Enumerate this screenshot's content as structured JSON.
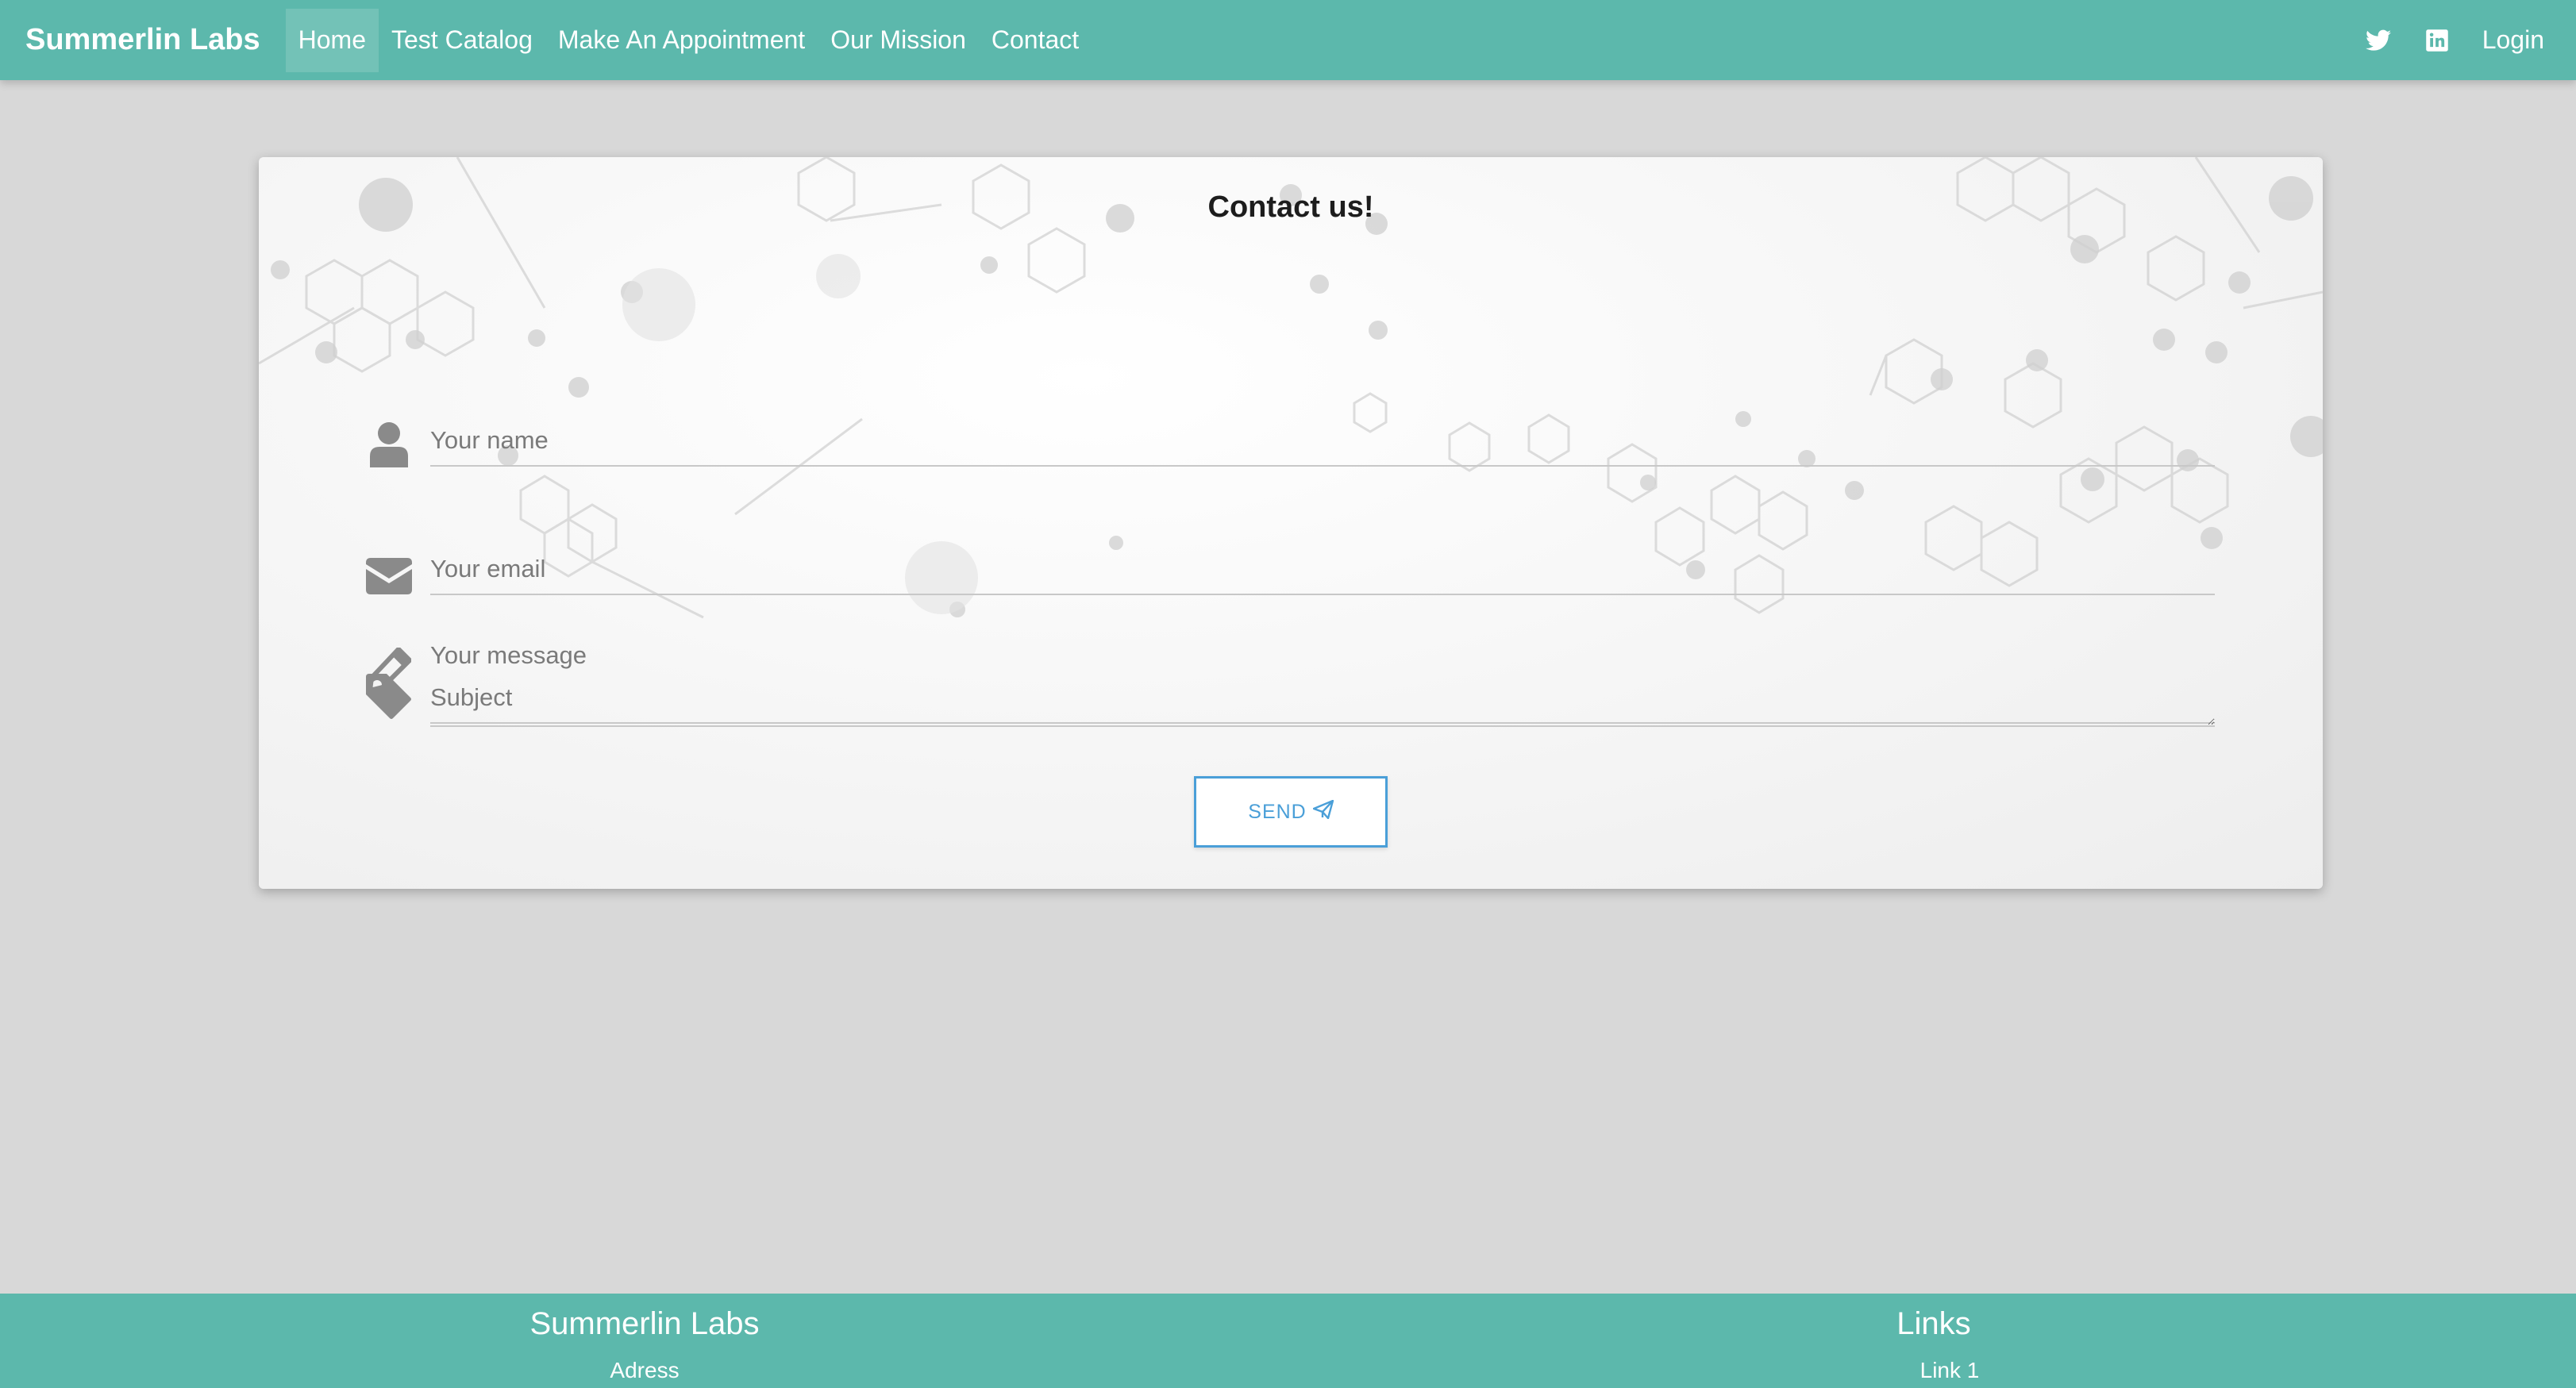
{
  "navbar": {
    "brand": "Summerlin Labs",
    "items": [
      {
        "label": "Home",
        "active": true
      },
      {
        "label": "Test Catalog",
        "active": false
      },
      {
        "label": "Make An Appointment",
        "active": false
      },
      {
        "label": "Our Mission",
        "active": false
      },
      {
        "label": "Contact",
        "active": false
      }
    ],
    "icons": [
      "twitter-icon",
      "linkedin-icon"
    ],
    "login": "Login"
  },
  "contact": {
    "title": "Contact us!",
    "fields": {
      "name": {
        "placeholder": "Your name",
        "icon": "user-icon"
      },
      "email": {
        "placeholder": "Your email",
        "icon": "envelope-icon"
      },
      "subject": {
        "placeholder": "Subject",
        "icon": "tag-icon"
      },
      "message": {
        "placeholder": "Your message",
        "icon": "pencil-icon"
      }
    },
    "send_label": "SEND",
    "send_icon": "paper-plane-icon"
  },
  "footer": {
    "left_title": "Summerlin Labs",
    "left_sub": "Adress",
    "right_title": "Links",
    "right_sub": "Link 1"
  },
  "colors": {
    "brand": "#5cb8ac",
    "accent": "#4a9fd8",
    "page_bg": "#d8d8d8"
  }
}
